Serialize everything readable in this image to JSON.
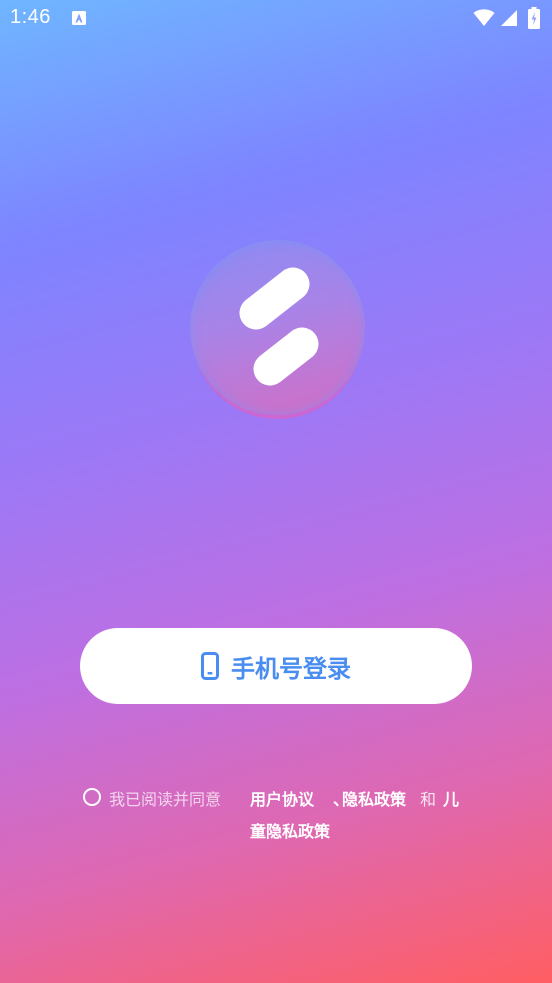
{
  "status_bar": {
    "time": "1:46",
    "icons": [
      "a-notification-icon",
      "wifi-icon",
      "signal-icon",
      "battery-icon"
    ]
  },
  "logo": {
    "icon": "app-logo-icon"
  },
  "login": {
    "label": "手机号登录",
    "icon": "phone-icon",
    "color": "#4A8DF0"
  },
  "agreement": {
    "prefix": "我已阅读并同意",
    "user_agreement": "用户协议",
    "separator": "、",
    "privacy_policy": "隐私政策",
    "and": "和",
    "child_privacy_line1": "儿",
    "child_privacy_line2": "童隐私政策"
  },
  "colors": {
    "gradient_top": "#6FB6FF",
    "gradient_mid": "#9C78F6",
    "gradient_bottom": "#FF5E62",
    "button_bg": "#FFFFFF"
  }
}
